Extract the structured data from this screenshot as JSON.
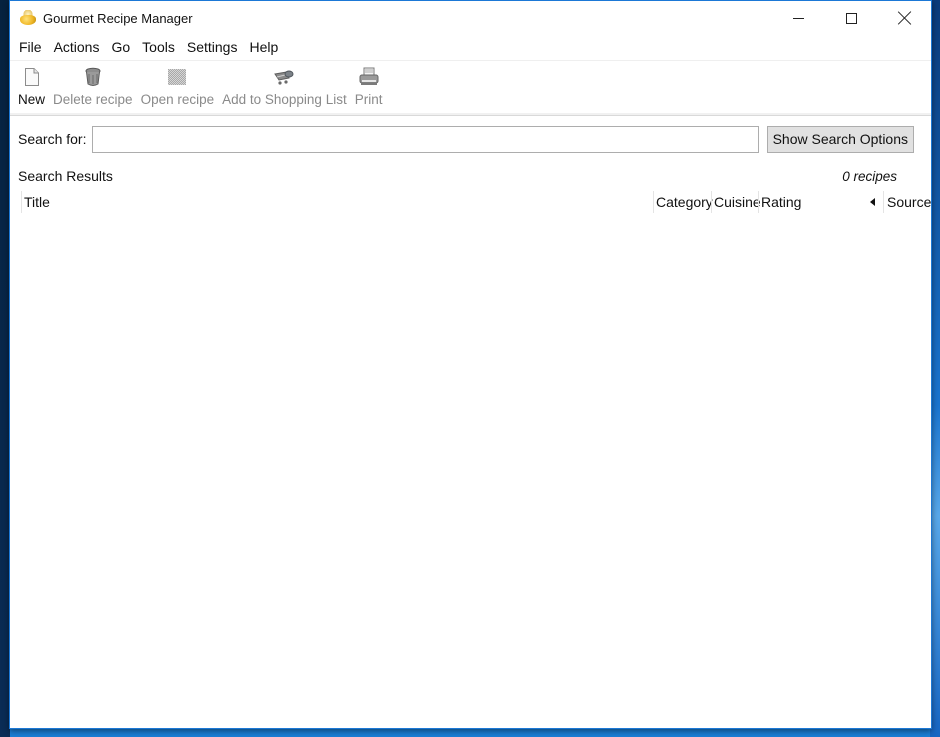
{
  "window": {
    "title": "Gourmet Recipe Manager",
    "app_icon": "cooking-pot-icon",
    "controls": {
      "minimize": "minimize-icon",
      "maximize": "maximize-icon",
      "close": "close-icon"
    }
  },
  "menubar": {
    "items": [
      {
        "label": "File"
      },
      {
        "label": "Actions"
      },
      {
        "label": "Go"
      },
      {
        "label": "Tools"
      },
      {
        "label": "Settings"
      },
      {
        "label": "Help"
      }
    ]
  },
  "toolbar": {
    "items": [
      {
        "label": "New",
        "icon": "new-document-icon",
        "enabled": true
      },
      {
        "label": "Delete recipe",
        "icon": "trash-can-icon",
        "enabled": false
      },
      {
        "label": "Open recipe",
        "icon": "open-recipe-icon",
        "enabled": false
      },
      {
        "label": "Add to Shopping List",
        "icon": "shopping-cart-icon",
        "enabled": false
      },
      {
        "label": "Print",
        "icon": "printer-icon",
        "enabled": true
      }
    ]
  },
  "search": {
    "label": "Search for:",
    "value": "",
    "placeholder": "",
    "options_button": "Show Search Options"
  },
  "results": {
    "title": "Search Results",
    "count": "0 recipes",
    "columns": [
      "Title",
      "Category",
      "Cuisine",
      "Rating",
      "Source"
    ],
    "sort_indicator": "sort-left-arrow-icon",
    "rows": []
  }
}
